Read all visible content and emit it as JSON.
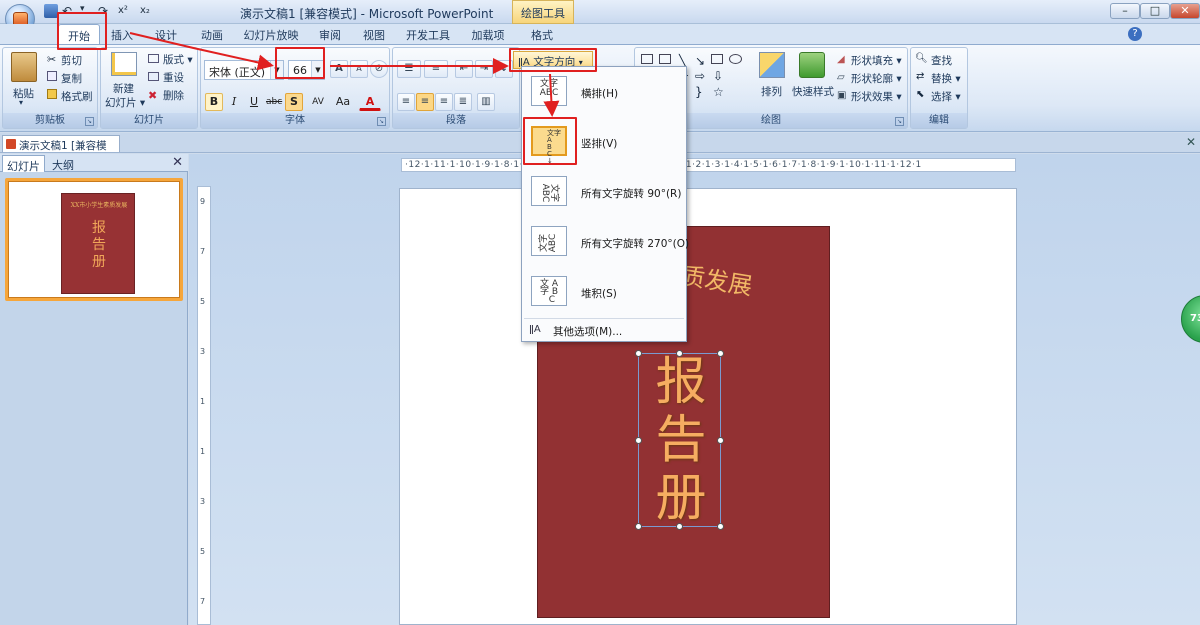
{
  "titlebar": {
    "title": "演示文稿1 [兼容模式] - Microsoft PowerPoint",
    "contextual_tab": "绘图工具",
    "min": "–",
    "max": "□",
    "close": "✕"
  },
  "qat": {
    "undo": "↶",
    "redo": "↷",
    "more": "▾"
  },
  "tabs": [
    "开始",
    "插入",
    "设计",
    "动画",
    "幻灯片放映",
    "审阅",
    "视图",
    "开发工具",
    "加载项",
    "格式"
  ],
  "help": "?",
  "ribbon": {
    "clipboard": {
      "label": "剪贴板",
      "paste": "粘贴",
      "cut": "剪切",
      "copy": "复制",
      "format_painter": "格式刷"
    },
    "slides": {
      "label": "幻灯片",
      "new_slide_line1": "新建",
      "new_slide_line2": "幻灯片 ▾",
      "layout": "版式 ▾",
      "reset": "重设",
      "delete": "删除"
    },
    "font": {
      "label": "字体",
      "font_name": "宋体 (正文)",
      "font_size": "66",
      "bold": "B",
      "italic": "I",
      "underline": "U",
      "strike": "abc",
      "shadow": "S",
      "spacing": "AV",
      "case": "Aa",
      "color": "A",
      "grow": "A",
      "shrink": "A"
    },
    "paragraph": {
      "label": "段落",
      "text_direction": "文字方向"
    },
    "drawing": {
      "label": "绘图",
      "arrange": "排列",
      "quick_styles": "快速样式",
      "shape_fill": "形状填充 ▾",
      "shape_outline": "形状轮廓 ▾",
      "shape_effects": "形状效果 ▾"
    },
    "editing": {
      "label": "编辑",
      "find": "查找",
      "replace": "替换 ▾",
      "select": "选择 ▾"
    }
  },
  "doc_tab": "演示文稿1 [兼容模式]",
  "pane": {
    "tab_slides": "幻灯片",
    "tab_outline": "大纲",
    "slide_number": "1"
  },
  "ruler": {
    "h": "·12·1·11·1·10·1·9·1·8·1·7·1·6·1·5·1·4·1·3·1·2·1·1·1·0·1·1·1·2·1·3·1·4·1·5·1·6·1·7·1·8·1·9·1·10·1·11·1·12·1"
  },
  "slide": {
    "subtitle": "XX市小学生素质发展",
    "subtitle_visible": "生素质发展",
    "title": "报告册"
  },
  "menu": {
    "items": [
      {
        "icon": "文字\nABC",
        "label": "横排(H)"
      },
      {
        "icon": "文字 ABC",
        "label": "竖排(V)"
      },
      {
        "icon": "文字\nABC",
        "label": "所有文字旋转 90°(R)"
      },
      {
        "icon": "文字\nABC",
        "label": "所有文字旋转 270°(O)"
      },
      {
        "icon": "文 A\n字 B\nC",
        "label": "堆积(S)"
      }
    ],
    "more": "其他选项(M)..."
  },
  "badge": "73",
  "accent_colors": {
    "highlight": "#e02020",
    "cover": "#923133",
    "title_text": "#f6ad61"
  }
}
